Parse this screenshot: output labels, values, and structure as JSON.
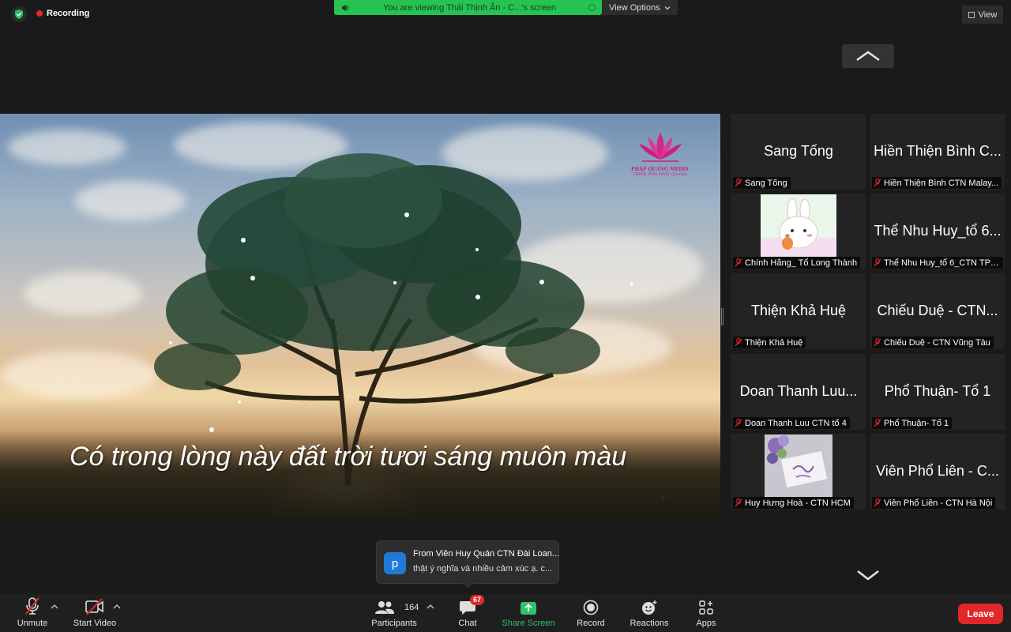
{
  "top": {
    "recording_label": "Recording",
    "banner_text": "You are viewing Thái Thịnh Ân - C...'s screen",
    "view_options_label": "View Options",
    "view_label": "View"
  },
  "screen": {
    "logo_title": "PHÁP QUANG MEDIA",
    "logo_subtitle": "THIỀN TÔN PHẬT QUANG",
    "lyric": "Có trong lòng này đất trời tươi sáng muôn màu"
  },
  "participants": [
    {
      "display": "Sang Tống",
      "name": "Sang Tống"
    },
    {
      "display": "Hiền Thiện Bình  C...",
      "name": "Hiền Thiện Bình  CTN Malay..."
    },
    {
      "display": "",
      "name": "Chính Hằng_ Tổ Long Thành"
    },
    {
      "display": "Thể Nhu Huy_tổ 6...",
      "name": "Thể Nhu Huy_tổ 6_CTN TPH..."
    },
    {
      "display": "Thiện Khả Huệ",
      "name": "Thiện Khả Huệ"
    },
    {
      "display": "Chiếu Duệ - CTN...",
      "name": "Chiếu Duệ - CTN Vũng Tàu"
    },
    {
      "display": "Doan Thanh Luu...",
      "name": "Doan Thanh Luu CTN tổ 4"
    },
    {
      "display": "Phổ Thuận- Tổ 1",
      "name": "Phổ Thuận- Tổ 1"
    },
    {
      "display": "",
      "name": "Huy Hưng Hoà -  CTN HCM"
    },
    {
      "display": "Viên Phổ Liên - C...",
      "name": "Viên Phổ Liên - CTN Hà Nội"
    }
  ],
  "chat_popup": {
    "avatar_letter": "p",
    "from": "From Viên Huy Quán CTN Đài Loan...",
    "message": "thật ý nghĩa và nhiều cảm xúc ạ. c..."
  },
  "toolbar": {
    "unmute": "Unmute",
    "start_video": "Start Video",
    "participants": "Participants",
    "participant_count": "164",
    "chat": "Chat",
    "chat_badge": "67",
    "share_screen": "Share Screen",
    "record": "Record",
    "reactions": "Reactions",
    "apps": "Apps",
    "leave": "Leave"
  },
  "colors": {
    "banner_green": "#25c452",
    "share_green": "#30c36a",
    "leave_red": "#e02828",
    "muted_red": "#e02828"
  }
}
